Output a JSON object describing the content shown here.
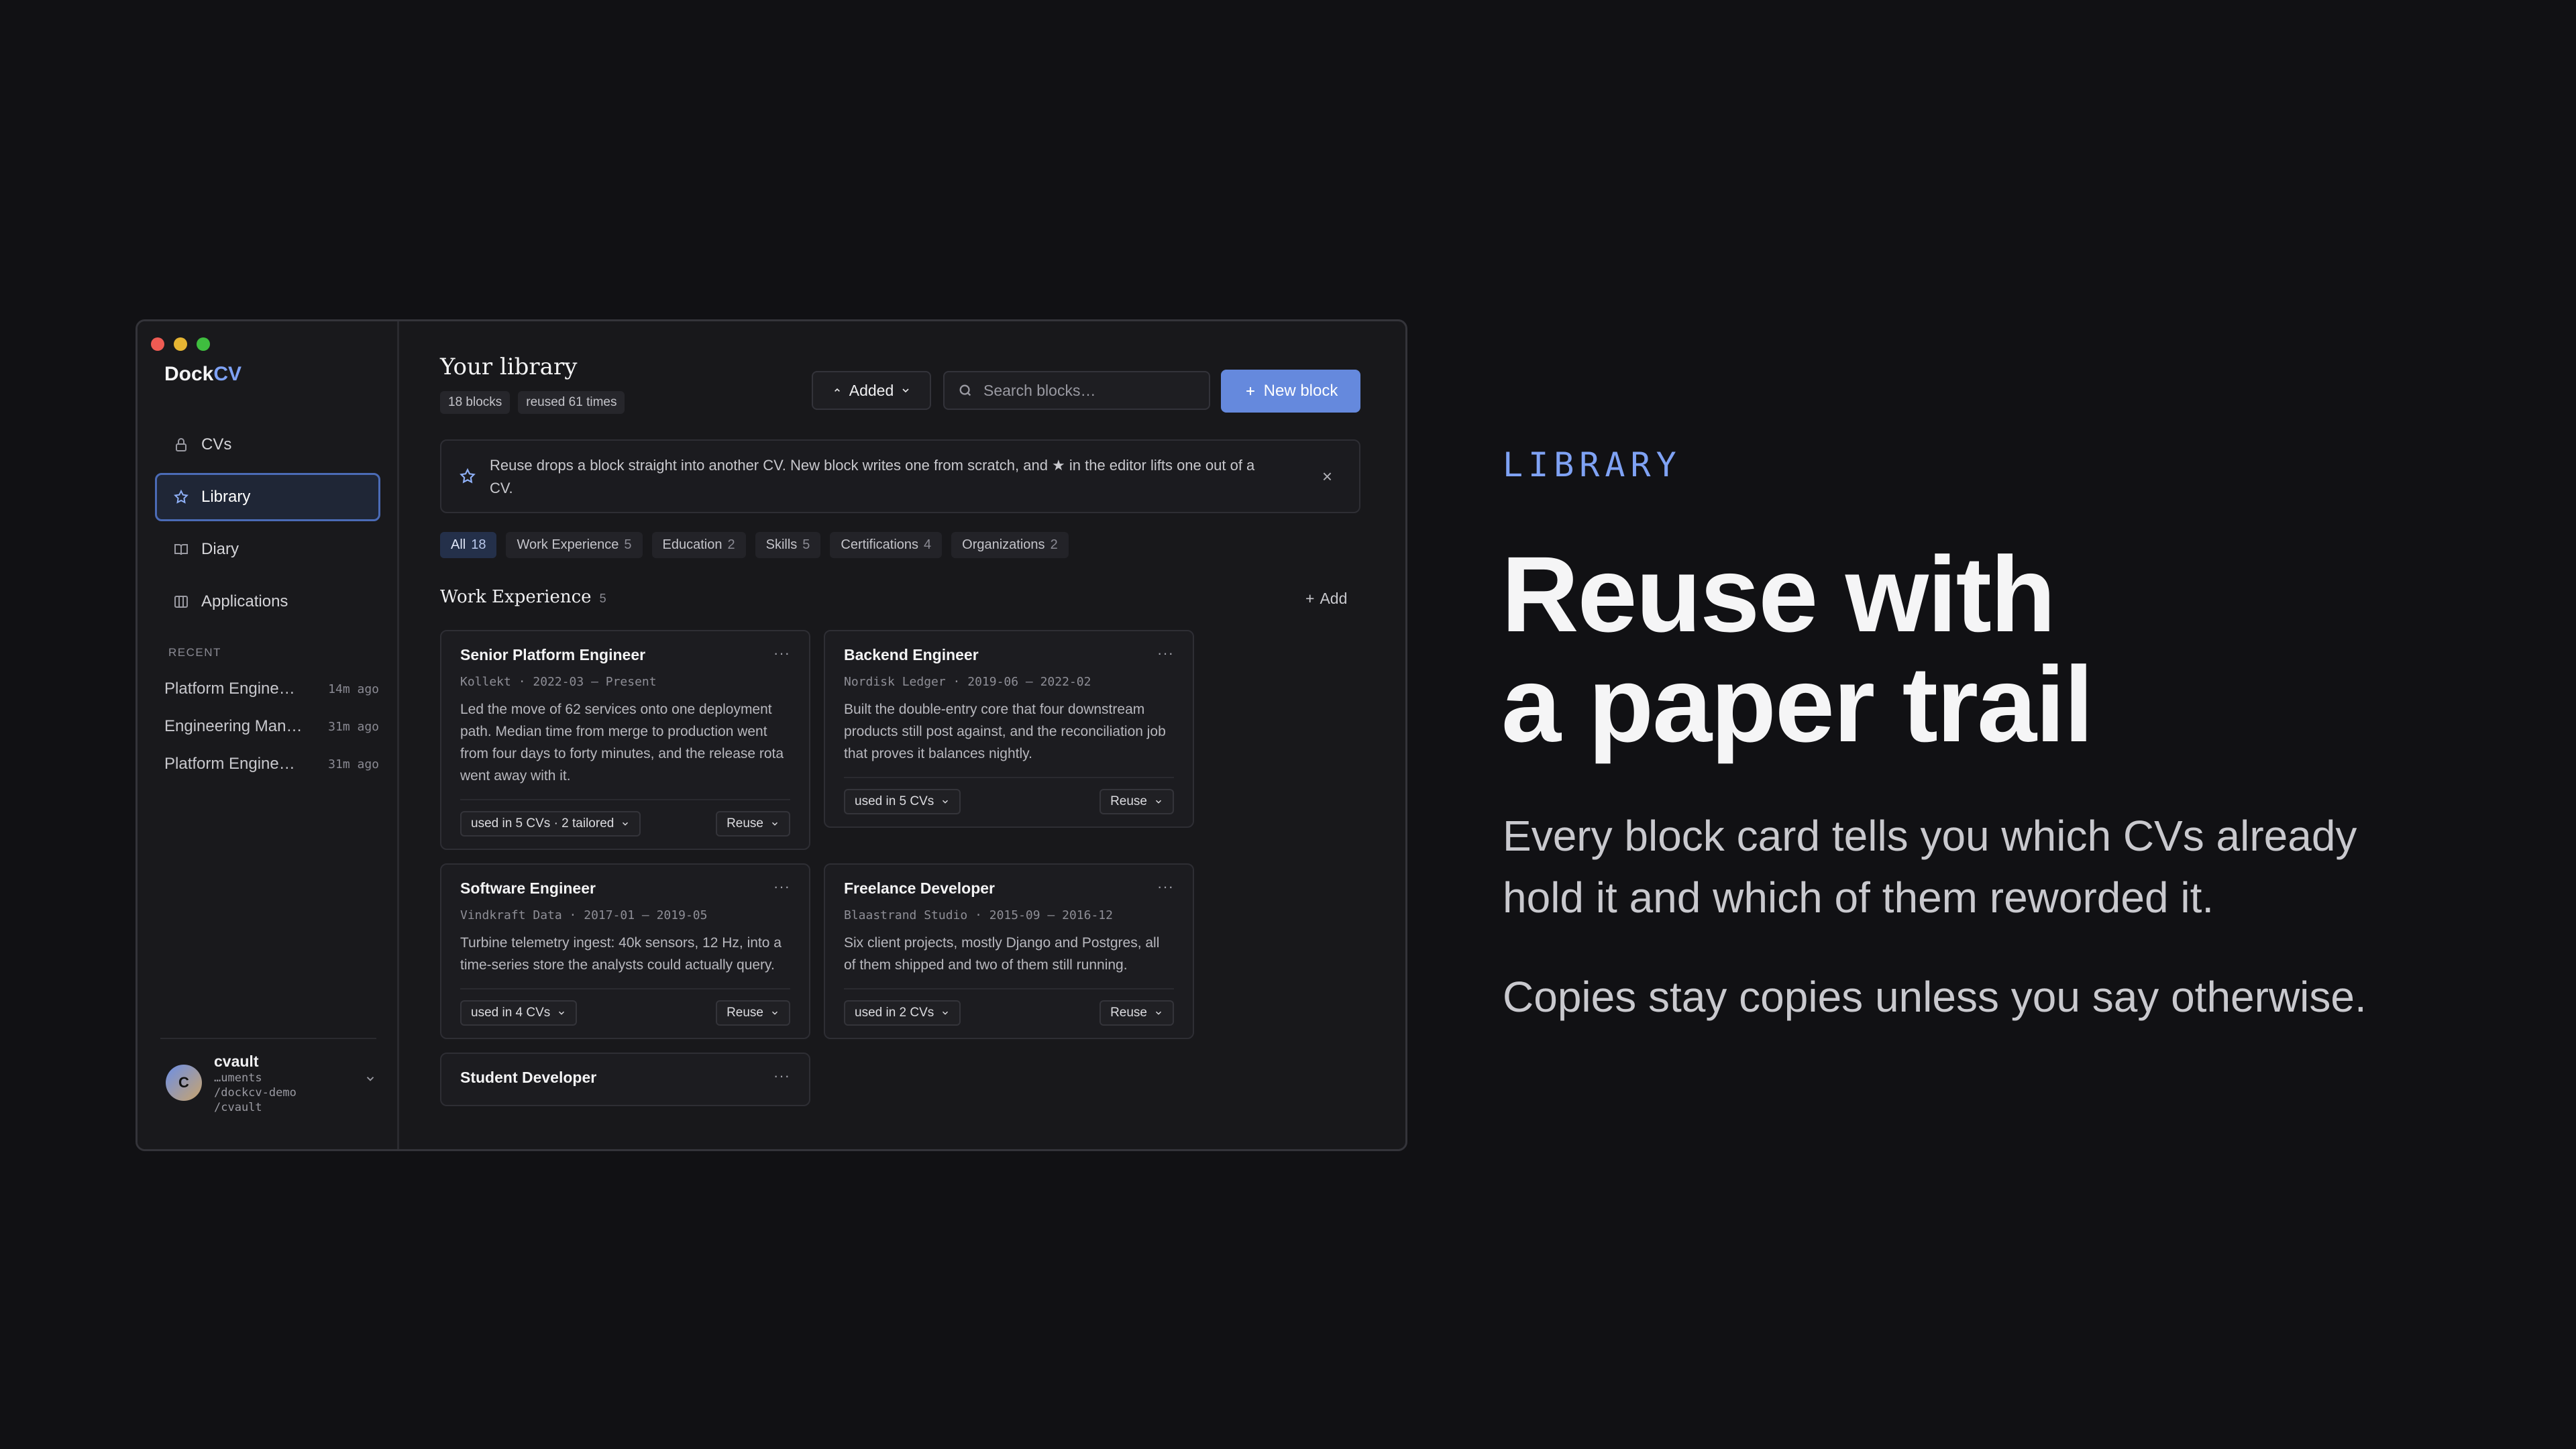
{
  "app": {
    "brand_main": "Dock",
    "brand_accent": "CV",
    "accent_color": "#6589dd"
  },
  "sidebar": {
    "items": [
      {
        "label": "CVs",
        "icon": "lock-icon"
      },
      {
        "label": "Library",
        "icon": "star-icon",
        "active": true
      },
      {
        "label": "Diary",
        "icon": "book-icon"
      },
      {
        "label": "Applications",
        "icon": "columns-icon"
      }
    ],
    "recent_label": "RECENT",
    "recent": [
      {
        "name": "Platform Enginee…",
        "time": "14m ago"
      },
      {
        "name": "Engineering Man…",
        "time": "31m ago"
      },
      {
        "name": "Platform Enginee…",
        "time": "31m ago"
      }
    ],
    "user": {
      "initial": "C",
      "name": "cvault",
      "path_line1": "…uments",
      "path_line2": "/dockcv-demo",
      "path_line3": "/cvault"
    }
  },
  "main": {
    "title": "Your library",
    "stat_blocks": "18 blocks",
    "stat_reused": "reused 61 times",
    "sort_label": "Added",
    "search_placeholder": "Search blocks…",
    "new_block_label": "New block",
    "tip_text": "Reuse drops a block straight into another CV. New block writes one from scratch, and ★ in the editor lifts one out of a CV.",
    "filters": [
      {
        "label": "All",
        "count": "18",
        "active": true
      },
      {
        "label": "Work Experience",
        "count": "5"
      },
      {
        "label": "Education",
        "count": "2"
      },
      {
        "label": "Skills",
        "count": "5"
      },
      {
        "label": "Certifications",
        "count": "4"
      },
      {
        "label": "Organizations",
        "count": "2"
      }
    ],
    "section_title": "Work Experience",
    "section_count": "5",
    "add_label": "Add",
    "reuse_label": "Reuse",
    "cards": [
      {
        "title": "Senior Platform Engineer",
        "meta": "Kollekt · 2022-03 – Present",
        "desc": "Led the move of 62 services onto one deployment path. Median time from merge to production went from four days to forty minutes, and the release rota went away with it.",
        "used": "used in 5 CVs · 2 tailored"
      },
      {
        "title": "Backend Engineer",
        "meta": "Nordisk Ledger · 2019-06 – 2022-02",
        "desc": "Built the double-entry core that four downstream products still post against, and the reconciliation job that proves it balances nightly.",
        "used": "used in 5 CVs"
      },
      {
        "title": "Software Engineer",
        "meta": "Vindkraft Data · 2017-01 – 2019-05",
        "desc": "Turbine telemetry ingest: 40k sensors, 12 Hz, into a time-series store the analysts could actually query.",
        "used": "used in 4 CVs"
      },
      {
        "title": "Freelance Developer",
        "meta": "Blaastrand Studio · 2015-09 – 2016-12",
        "desc": "Six client projects, mostly Django and Postgres, all of them shipped and two of them still running.",
        "used": "used in 2 CVs"
      },
      {
        "title": "Student Developer"
      }
    ]
  },
  "marketing": {
    "eyebrow": "LIBRARY",
    "headline_line1": "Reuse with",
    "headline_line2": "a paper trail",
    "para1": "Every block card tells you which CVs already hold it and which of them reworded it.",
    "para2": "Copies stay copies unless you say otherwise."
  }
}
